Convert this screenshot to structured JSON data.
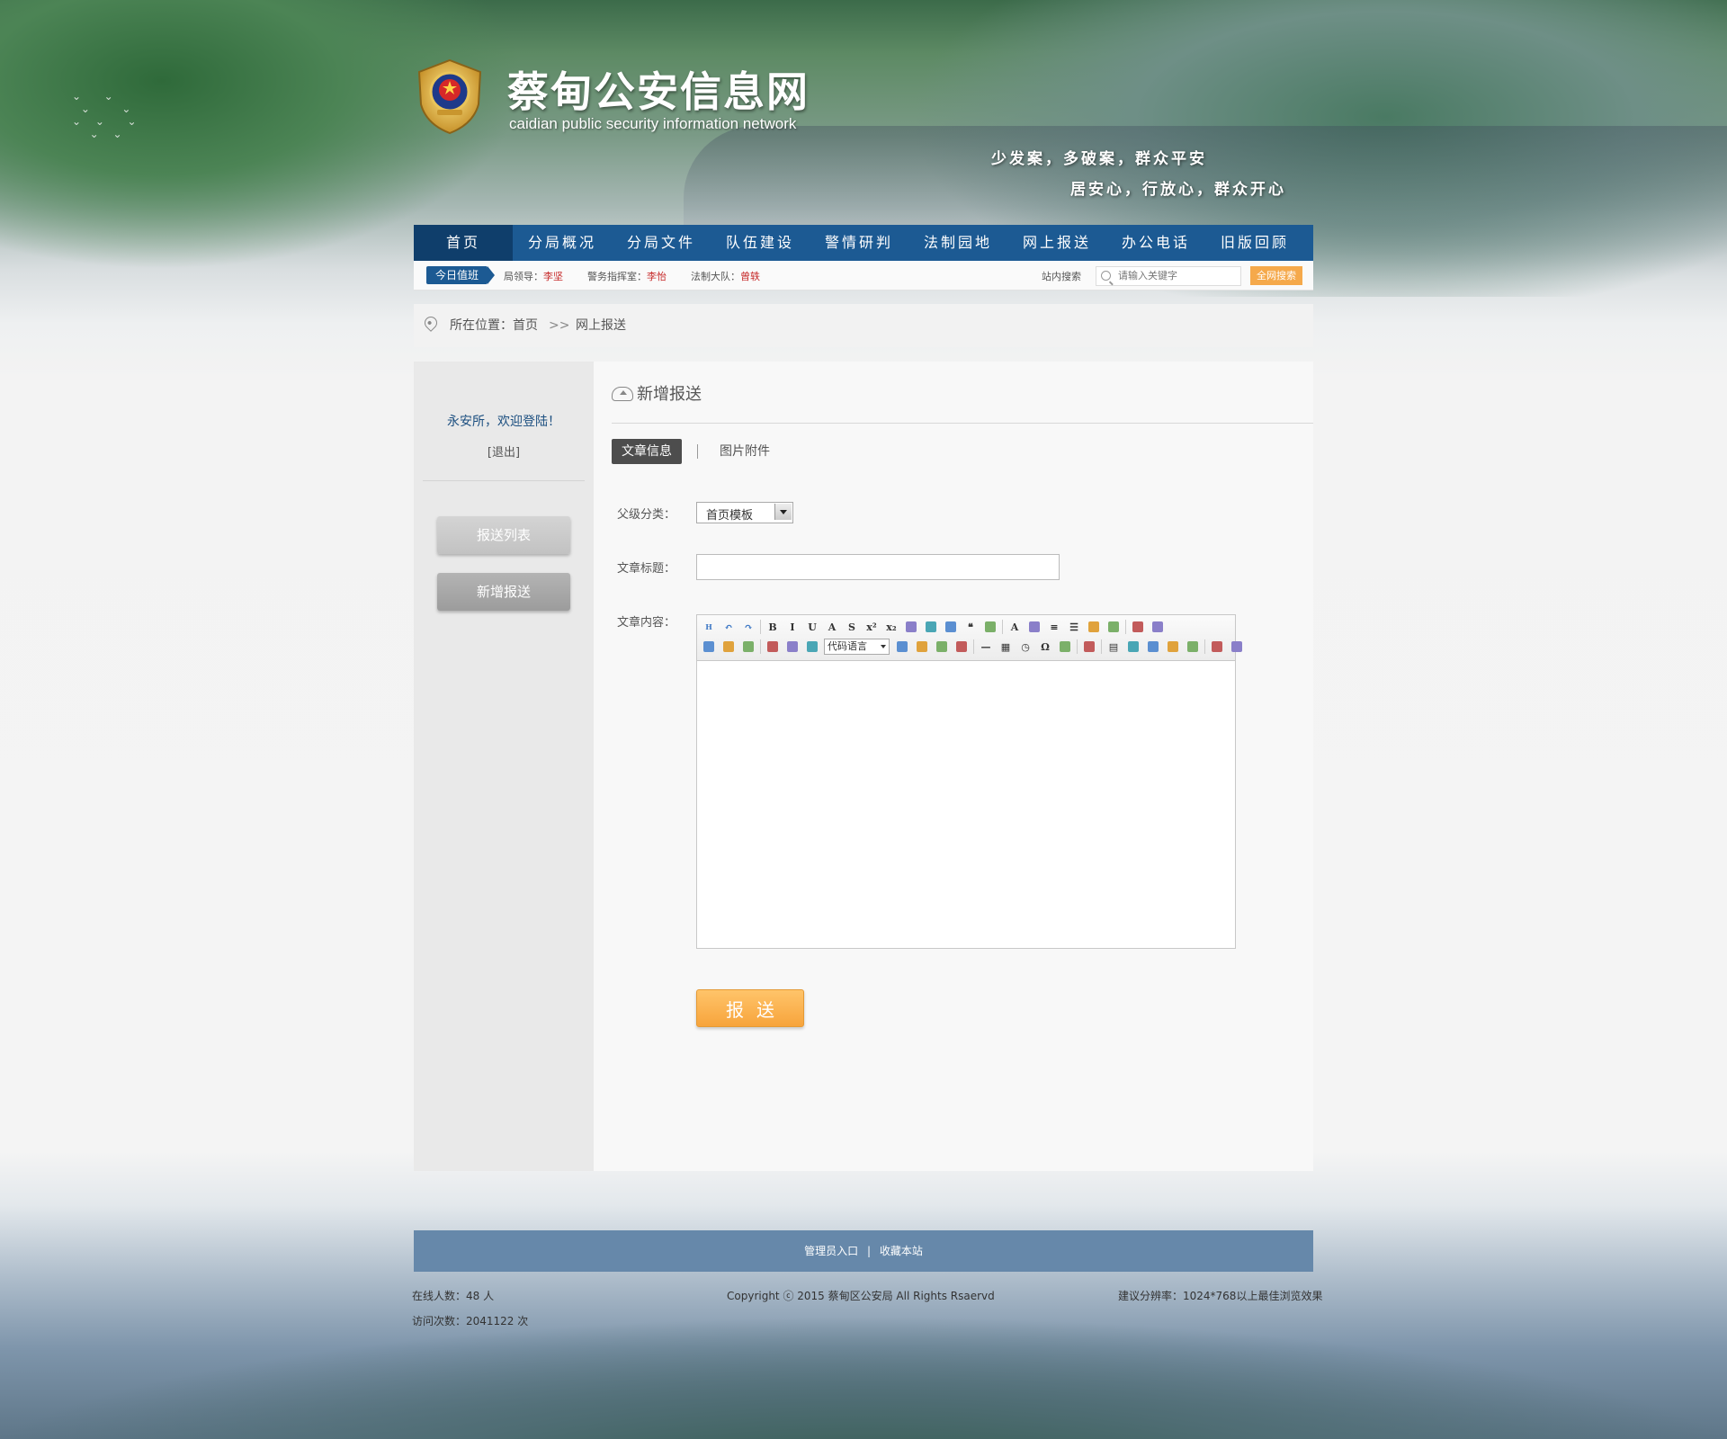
{
  "header": {
    "site_title": "蔡甸公安信息网",
    "site_subtitle": "caidian  public security information network",
    "slogan_line1": "少发案，多破案，群众平安",
    "slogan_line2": "居安心，行放心，群众开心"
  },
  "nav": {
    "items": [
      {
        "label": "首页",
        "active": true
      },
      {
        "label": "分局概况"
      },
      {
        "label": "分局文件"
      },
      {
        "label": "队伍建设"
      },
      {
        "label": "警情研判"
      },
      {
        "label": "法制园地"
      },
      {
        "label": "网上报送"
      },
      {
        "label": "办公电话"
      },
      {
        "label": "旧版回顾"
      }
    ]
  },
  "duty": {
    "tag": "今日值班",
    "items": [
      {
        "role": "局领导：",
        "name": "李坚"
      },
      {
        "role": "警务指挥室：",
        "name": "李怡"
      },
      {
        "role": "法制大队：",
        "name": "曾轶"
      }
    ],
    "search_label": "站内搜索",
    "search_placeholder": "请输入关键字",
    "search_button": "全网搜索"
  },
  "breadcrumb": {
    "prefix": "所在位置：",
    "home": "首页",
    "separator": ">>",
    "current": "网上报送"
  },
  "sidebar": {
    "welcome": "永安所，欢迎登陆！",
    "logout": "[退出]",
    "buttons": [
      {
        "label": "报送列表"
      },
      {
        "label": "新增报送",
        "active": true
      }
    ]
  },
  "form": {
    "section_title": "新增报送",
    "tabs": [
      {
        "label": "文章信息",
        "active": true
      },
      {
        "label": "图片附件"
      }
    ],
    "category_label": "父级分类：",
    "category_value": "首页模板",
    "title_label": "文章标题：",
    "title_value": "",
    "content_label": "文章内容：",
    "editor_code_language": "代码语言",
    "editor_row1_icons": [
      "html-icon",
      "undo-icon",
      "redo-icon",
      "bold-icon",
      "italic-icon",
      "underline-icon",
      "font-border-icon",
      "strikethrough-icon",
      "superscript-icon",
      "subscript-icon",
      "eraser-icon",
      "format-painter-icon",
      "auto-format-icon",
      "blockquote-icon",
      "paste-plain-icon",
      "font-color-icon",
      "highlight-icon",
      "ordered-list-icon",
      "unordered-list-icon",
      "select-all-icon",
      "clear-doc-icon",
      "line-height-icon",
      "paragraph-icon"
    ],
    "editor_row2_icons": [
      "save-icon",
      "music-icon",
      "attachment-icon",
      "image-icon",
      "multi-image-icon",
      "map-icon",
      "code-icon",
      "web-icon",
      "table-insert-icon",
      "template-icon",
      "horizontal-rule-icon",
      "date-icon",
      "time-icon",
      "special-char-icon",
      "preview-icon",
      "print-icon",
      "table-icon",
      "cell-merge-icon",
      "cell-split-icon",
      "insert-row-icon",
      "delete-row-icon",
      "insert-col-icon",
      "delete-col-icon"
    ],
    "submit": "报送"
  },
  "footer": {
    "admin_link": "管理员入口",
    "divider": "|",
    "bookmark_link": "收藏本站",
    "online": "在线人数：48 人",
    "visits": "访问次数：2041122 次",
    "copyright": "Copyright ⓒ 2015   蔡甸区公安局   All Rights Rsaervd",
    "resolution": "建议分辨率：1024*768以上最佳浏览效果"
  },
  "colors": {
    "nav_bg": "#1c5a93",
    "nav_active": "#0f3e6b",
    "accent_orange": "#f7a43c",
    "footer_bar": "#6688aa",
    "duty_name": "#c62828"
  }
}
